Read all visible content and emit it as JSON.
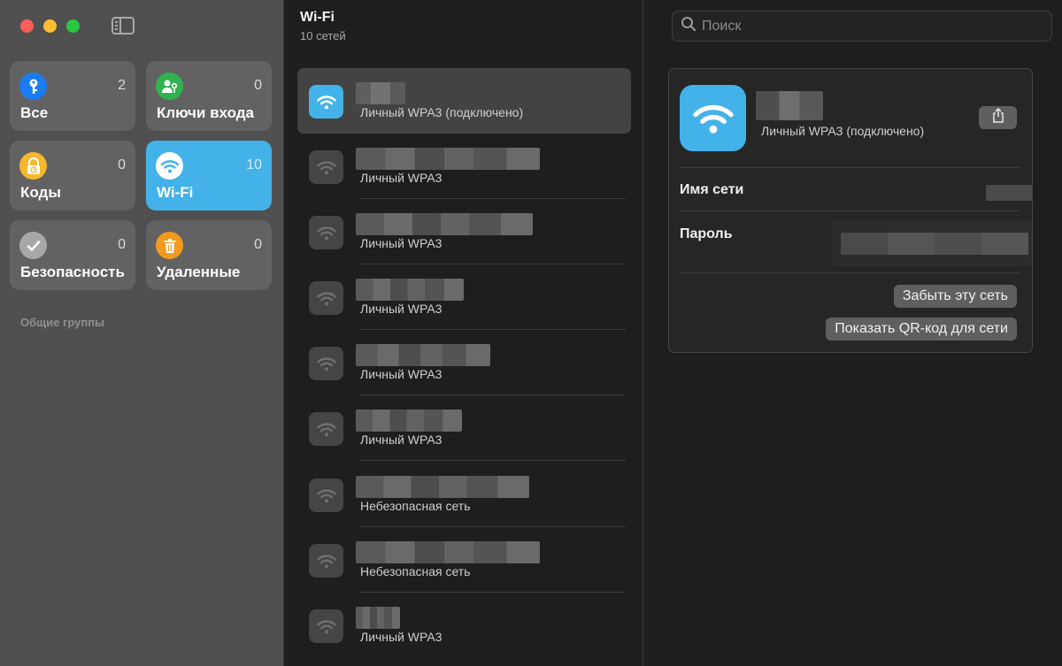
{
  "window": {
    "buttons": [
      "close",
      "minimize",
      "zoom"
    ]
  },
  "sidebar": {
    "toggle_icon": "sidebar-toggle-icon",
    "tiles": [
      {
        "label": "Все",
        "count": "2",
        "icon": "key-icon",
        "icon_color": "#1a7cf4",
        "active": false
      },
      {
        "label": "Ключи входа",
        "count": "0",
        "icon": "person-key-icon",
        "icon_color": "#2fb24f",
        "active": false
      },
      {
        "label": "Коды",
        "count": "0",
        "icon": "lock-clock-icon",
        "icon_color": "#f5b82e",
        "active": false
      },
      {
        "label": "Wi-Fi",
        "count": "10",
        "icon": "wifi-icon",
        "icon_color": "#ffffff",
        "active": true
      },
      {
        "label": "Безопасность",
        "count": "0",
        "icon": "checkmark-icon",
        "icon_color": "#a8a8a8",
        "active": false
      },
      {
        "label": "Удаленные",
        "count": "0",
        "icon": "trash-icon",
        "icon_color": "#f29a1d",
        "active": false
      }
    ],
    "groups_title": "Общие группы"
  },
  "list": {
    "title": "Wi-Fi",
    "subtitle": "10 сетей",
    "items": [
      {
        "security": "Личный WPA3 (подключено)",
        "selected": true
      },
      {
        "security": "Личный WPA3",
        "selected": false
      },
      {
        "security": "Личный WPA3",
        "selected": false
      },
      {
        "security": "Личный WPA3",
        "selected": false
      },
      {
        "security": "Личный WPA3",
        "selected": false
      },
      {
        "security": "Личный WPA3",
        "selected": false
      },
      {
        "security": "Небезопасная сеть",
        "selected": false
      },
      {
        "security": "Небезопасная сеть",
        "selected": false
      },
      {
        "security": "Личный WPA3",
        "selected": false
      }
    ]
  },
  "detail": {
    "search": {
      "placeholder": "Поиск",
      "value": ""
    },
    "network_security": "Личный WPA3 (подключено)",
    "network_name_label": "Имя сети",
    "password_label": "Пароль",
    "forget_button": "Забыть эту сеть",
    "show_qr_button": "Показать QR-код для сети",
    "share_icon": "share-icon"
  },
  "colors": {
    "accent": "#43b2e8",
    "sidebar_bg": "#505051",
    "tile_bg": "#626263",
    "pane_bg": "#1e1e1e"
  }
}
